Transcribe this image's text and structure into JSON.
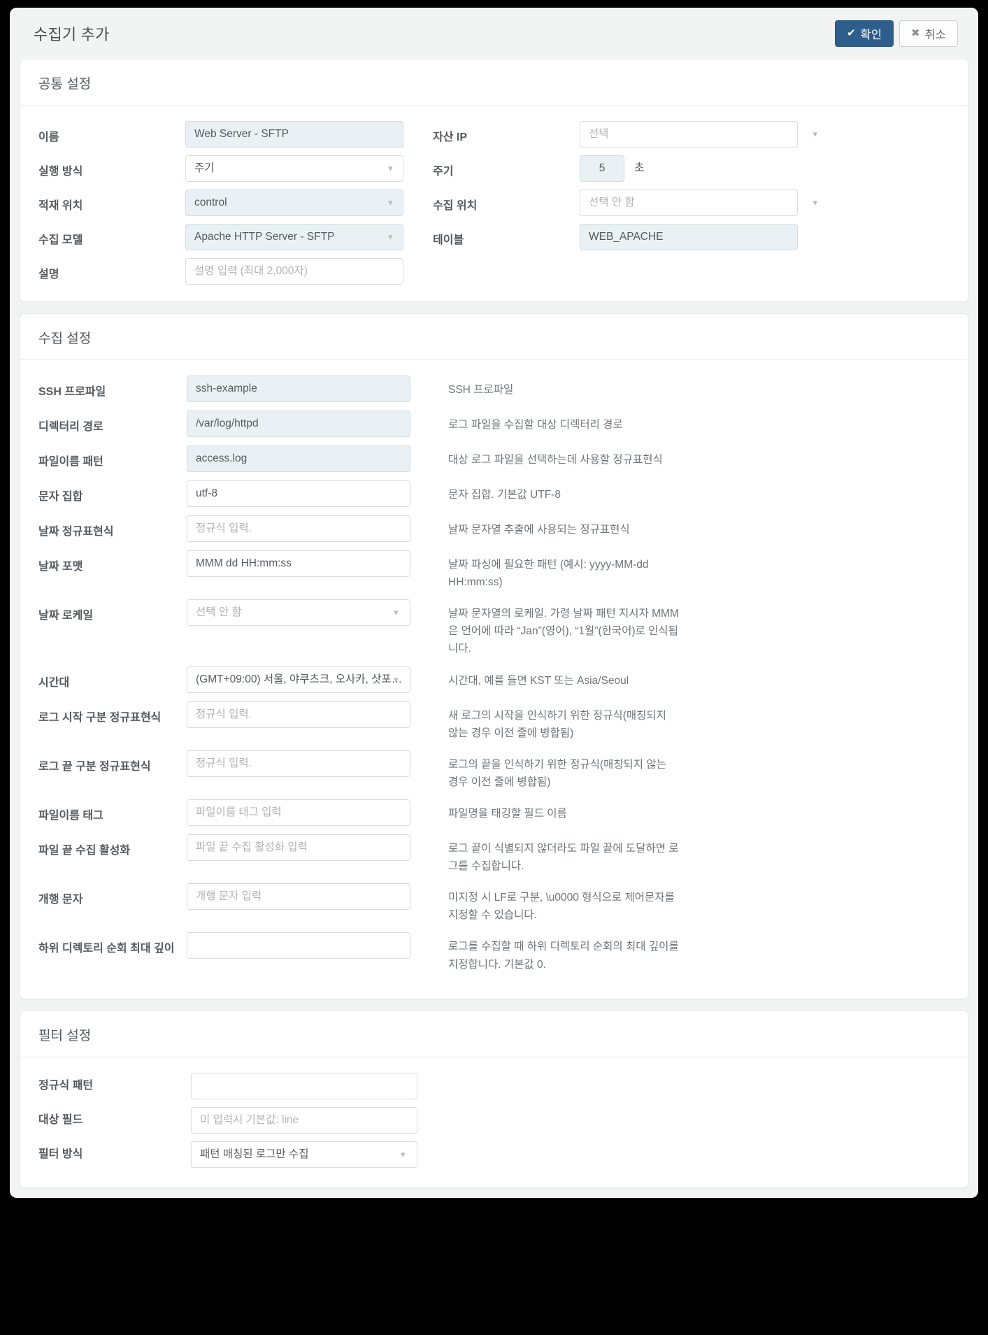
{
  "header": {
    "title": "수집기 추가",
    "confirm_label": "확인",
    "cancel_label": "취소",
    "confirm_icon": "check-icon",
    "cancel_icon": "cross-icon",
    "accent_color": "#2e5f8c"
  },
  "common": {
    "section_title": "공통 설정",
    "name_label": "이름",
    "name_value": "Web Server - SFTP",
    "exec_label": "실행 방식",
    "exec_value": "주기",
    "load_label": "적재 위치",
    "load_value": "control",
    "model_label": "수집 모델",
    "model_value": "Apache HTTP Server - SFTP",
    "desc_label": "설명",
    "desc_placeholder": "설명 입력 (최대 2,000자)",
    "asset_ip_label": "자산 IP",
    "asset_ip_placeholder": "선택",
    "interval_label": "주기",
    "interval_value": "5",
    "interval_unit": "초",
    "collect_loc_label": "수집 위치",
    "collect_loc_placeholder": "선택 안 함",
    "table_label": "테이블",
    "table_value": "WEB_APACHE"
  },
  "collect": {
    "section_title": "수집 설정",
    "rows": [
      {
        "label": "SSH 프로파일",
        "value": "ssh-example",
        "placeholder": "",
        "filled": true,
        "type": "text",
        "help": "SSH 프로파일"
      },
      {
        "label": "디렉터리 경로",
        "value": "/var/log/httpd",
        "placeholder": "",
        "filled": true,
        "type": "text",
        "help": "로그 파일을 수집할 대상 디렉터리 경로"
      },
      {
        "label": "파일이름 패턴",
        "value": "access.log",
        "placeholder": "",
        "filled": true,
        "type": "text",
        "help": "대상 로그 파일을 선택하는데 사용할 정규표현식"
      },
      {
        "label": "문자 집합",
        "value": "utf-8",
        "placeholder": "",
        "filled": false,
        "type": "text",
        "help": "문자 집합. 기본값 UTF-8"
      },
      {
        "label": "날짜 정규표현식",
        "value": "",
        "placeholder": "정규식 입력.",
        "filled": false,
        "type": "text",
        "help": "날짜 문자열 추출에 사용되는 정규표현식"
      },
      {
        "label": "날짜 포맷",
        "value": "MMM dd HH:mm:ss",
        "placeholder": "",
        "filled": false,
        "type": "text",
        "help": "날짜 파싱에 필요한 패턴 (예시: yyyy-MM-dd HH:mm:ss)"
      },
      {
        "label": "날짜 로케일",
        "value": "",
        "placeholder": "선택 안 함",
        "filled": false,
        "type": "select",
        "help": "날짜 문자열의 로케일. 가령 날짜 패턴 지시자 MMM은 언어에 따라 “Jan”(영어), “1월”(한국어)로 인식됩니다."
      },
      {
        "label": "시간대",
        "value": "(GMT+09:00) 서울, 야쿠츠크, 오사카, 삿포…",
        "placeholder": "",
        "filled": false,
        "type": "select",
        "help": "시간대, 예를 들면 KST 또는 Asia/Seoul"
      },
      {
        "label": "로그 시작 구분 정규표현식",
        "value": "",
        "placeholder": "정규식 입력.",
        "filled": false,
        "type": "text",
        "help": "새 로그의 시작을 인식하기 위한 정규식(매칭되지 않는 경우 이전 줄에 병합됨)"
      },
      {
        "label": "로그 끝 구분 정규표현식",
        "value": "",
        "placeholder": "정규식 입력.",
        "filled": false,
        "type": "text",
        "help": "로그의 끝을 인식하기 위한 정규식(매칭되지 않는 경우 이전 줄에 병합됨)"
      },
      {
        "label": "파일이름 태그",
        "value": "",
        "placeholder": "파일이름 태그 입력",
        "filled": false,
        "type": "text",
        "help": "파일명을 태깅할 필드 이름"
      },
      {
        "label": "파일 끝 수집 활성화",
        "value": "",
        "placeholder": "파일 끝 수집 활성화 입력",
        "filled": false,
        "type": "text",
        "help": "로그 끝이 식별되지 않더라도 파일 끝에 도달하면 로그를 수집합니다."
      },
      {
        "label": "개행 문자",
        "value": "",
        "placeholder": "개행 문자 입력",
        "filled": false,
        "type": "text",
        "help": "미지정 시 LF로 구분, \\u0000 형식으로 제어문자를 지정할 수 있습니다."
      },
      {
        "label": "하위 디렉토리 순회 최대 깊이",
        "value": "",
        "placeholder": "",
        "filled": false,
        "type": "text",
        "help": "로그를 수집할 때 하위 디렉토리 순회의 최대 깊이를 지정합니다. 기본값 0."
      }
    ]
  },
  "filter": {
    "section_title": "필터 설정",
    "pattern_label": "정규식 패턴",
    "pattern_value": "",
    "pattern_placeholder": "",
    "field_label": "대상 필드",
    "field_placeholder": "미 입력시 기본값: line",
    "mode_label": "필터 방식",
    "mode_value": "패턴 매칭된 로그만 수집"
  }
}
